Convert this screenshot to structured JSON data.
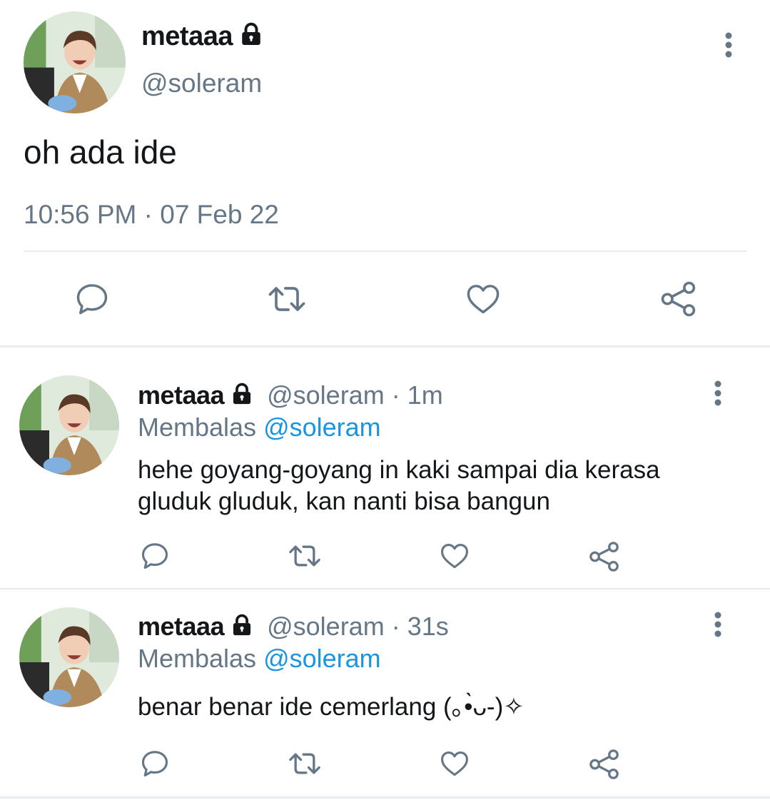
{
  "main_tweet": {
    "display_name": "metaaa",
    "handle": "@soleram",
    "text": "oh ada ide",
    "timestamp": "10:56 PM · 07 Feb 22",
    "icons": [
      "lock-icon",
      "more-vertical-icon",
      "reply-icon",
      "retweet-icon",
      "like-icon",
      "share-icon"
    ]
  },
  "replies": [
    {
      "display_name": "metaaa",
      "handle": "@soleram",
      "time": "· 1m",
      "replying_label": "Membalas",
      "replying_to": "@soleram",
      "text": "hehe goyang-goyang in kaki sampai dia kerasa gluduk gluduk, kan nanti bisa bangun"
    },
    {
      "display_name": "metaaa",
      "handle": "@soleram",
      "time": "· 31s",
      "replying_label": "Membalas",
      "replying_to": "@soleram",
      "text": "benar benar ide cemerlang (｡•̀ᴗ-)✧"
    }
  ],
  "colors": {
    "text_primary": "#14171a",
    "text_secondary": "#657786",
    "accent": "#1b95e0",
    "divider": "#e6ecf0"
  }
}
